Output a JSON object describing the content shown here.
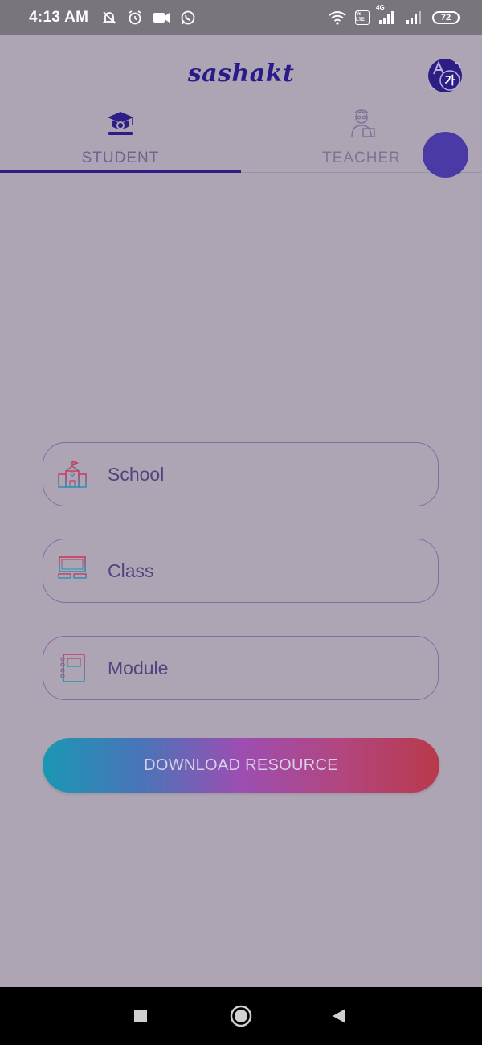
{
  "status_bar": {
    "time": "4:13 AM",
    "left_icons": [
      "mute-bell-icon",
      "alarm-icon",
      "video-camera-icon",
      "whatsapp-icon"
    ],
    "network_label": "4G",
    "volte_label": "Vo LTE",
    "battery": "72"
  },
  "header": {
    "logo": "sashakt",
    "translate_icon": "translate-icon"
  },
  "tabs": [
    {
      "label": "STUDENT",
      "icon": "graduation-cap-icon",
      "selected": true
    },
    {
      "label": "TEACHER",
      "icon": "teacher-icon",
      "selected": false
    }
  ],
  "form": {
    "school_label": "School",
    "class_label": "Class",
    "module_label": "Module",
    "download_label": "DOWNLOAD RESOURCE"
  },
  "nav": {
    "buttons": [
      "recent-apps-icon",
      "home-icon",
      "back-icon"
    ]
  },
  "colors": {
    "background": "#ada5b3",
    "accent": "#2d1e86",
    "field_border": "#7e6ea6"
  }
}
